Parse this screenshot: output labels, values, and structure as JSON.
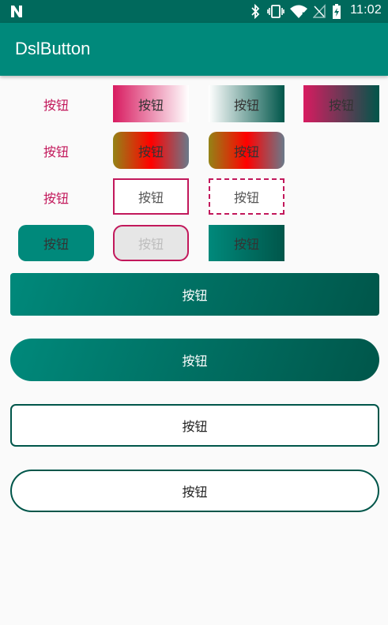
{
  "status_bar": {
    "time": "11:02",
    "icons": [
      "n-notification-icon",
      "bluetooth-icon",
      "vibrate-icon",
      "wifi-icon",
      "no-signal-icon",
      "battery-charging-icon"
    ]
  },
  "app_bar": {
    "title": "DslButton"
  },
  "colors": {
    "primary": "#00897b",
    "primary_dark": "#00695c",
    "accent": "#d81b60",
    "text_pink": "#c2185b"
  },
  "buttons": {
    "r1c1": "按钮",
    "r1c2": "按钮",
    "r1c3": "按钮",
    "r1c4": "按钮",
    "r2c1": "按钮",
    "r2c2": "按钮",
    "r2c3": "按钮",
    "r3c1": "按钮",
    "r3c2": "按钮",
    "r3c3": "按钮",
    "r4c1": "按钮",
    "r4c2": "按钮",
    "r4c3": "按钮",
    "wide1": "按钮",
    "wide2": "按钮",
    "wide3": "按钮",
    "wide4": "按钮"
  }
}
